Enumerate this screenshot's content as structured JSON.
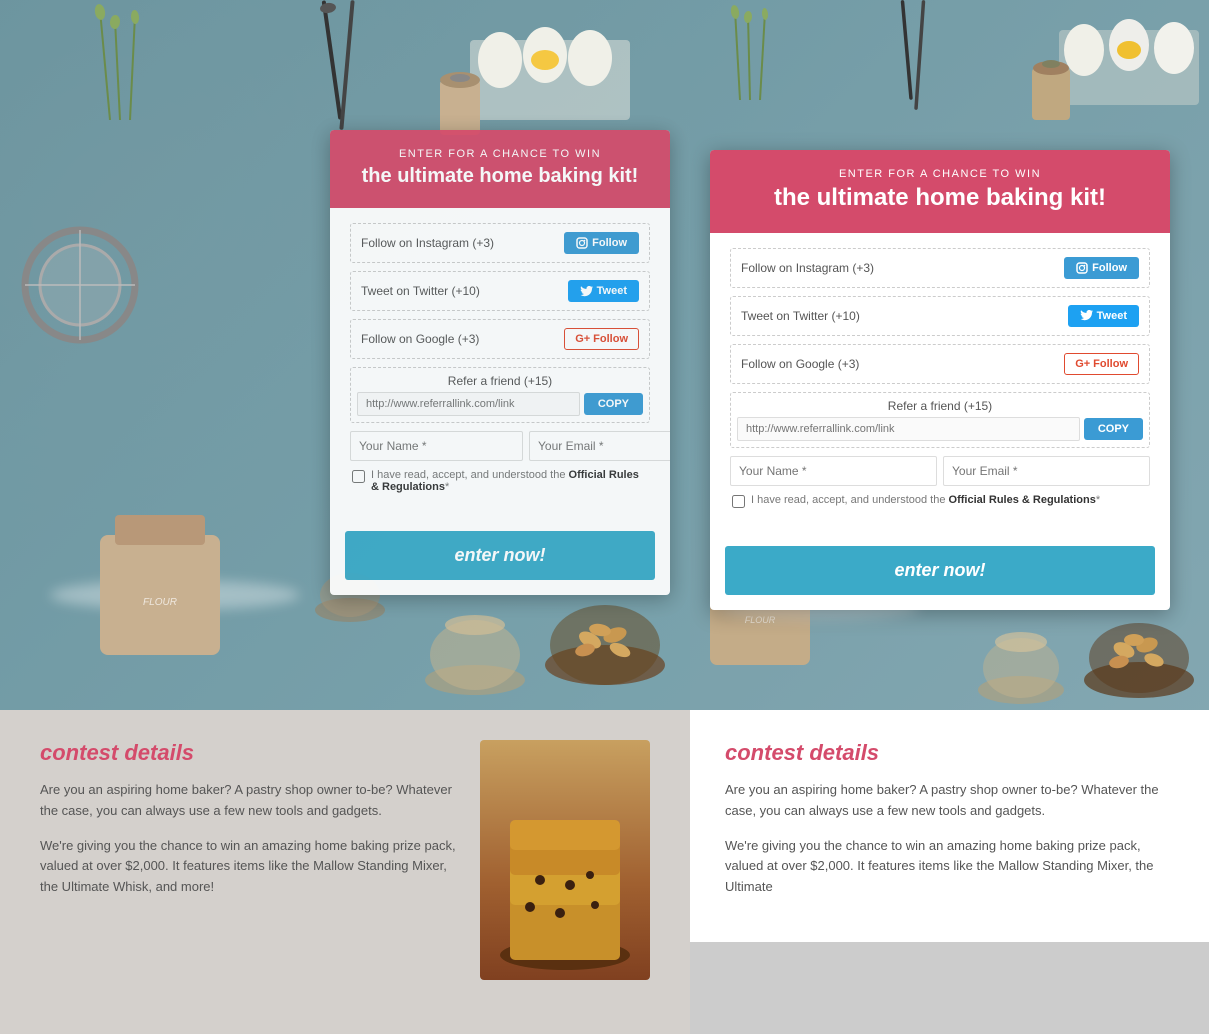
{
  "left_card": {
    "header": {
      "subtitle": "ENTER FOR A CHANCE TO WIN",
      "title": "the ultimate home baking kit!"
    },
    "actions": [
      {
        "label": "Follow on Instagram (+3)",
        "btn_text": "Follow",
        "btn_type": "follow"
      },
      {
        "label": "Tweet on Twitter (+10)",
        "btn_text": "Tweet",
        "btn_type": "tweet"
      },
      {
        "label": "Follow on Google (+3)",
        "btn_text": "Follow",
        "btn_type": "google"
      }
    ],
    "refer": {
      "label": "Refer a friend (+15)",
      "placeholder": "http://www.referrallink.com/link",
      "copy_btn": "COPY"
    },
    "name_placeholder": "Your Name *",
    "email_placeholder": "Your Email *",
    "checkbox_text": "I have read, accept, and understood the ",
    "checkbox_link": "Official Rules & Regulations",
    "checkbox_suffix": "*",
    "enter_btn": "enter now!"
  },
  "right_card": {
    "header": {
      "subtitle": "ENTER FOR A CHANCE TO WIN",
      "title": "the ultimate home baking kit!"
    },
    "actions": [
      {
        "label": "Follow on Instagram (+3)",
        "btn_text": "Follow",
        "btn_type": "follow"
      },
      {
        "label": "Tweet on Twitter (+10)",
        "btn_text": "Tweet",
        "btn_type": "tweet"
      },
      {
        "label": "Follow on Google (+3)",
        "btn_text": "Follow",
        "btn_type": "google"
      }
    ],
    "refer": {
      "label": "Refer a friend (+15)",
      "placeholder": "http://www.referrallink.com/link",
      "copy_btn": "COPY"
    },
    "name_placeholder": "Your Name *",
    "email_placeholder": "Your Email *",
    "checkbox_text": "I have read, accept, and understood the ",
    "checkbox_link": "Official Rules & Regulations",
    "checkbox_suffix": "*",
    "enter_btn": "enter now!"
  },
  "left_details": {
    "title": "contest details",
    "para1": "Are you an aspiring home baker? A pastry shop owner to-be? Whatever the case, you can always use a few new tools and gadgets.",
    "para2": "We're giving you the chance to win an amazing home baking prize pack, valued at over $2,000. It features items like the Mallow Standing Mixer, the Ultimate Whisk, and more!"
  },
  "right_details": {
    "title": "contest details",
    "para1": "Are you an aspiring home baker? A pastry shop owner to-be? Whatever the case, you can always use a few new tools and gadgets.",
    "para2": "We're giving you the chance to win an amazing home baking prize pack, valued at over $2,000. It features items like the Mallow Standing Mixer, the Ultimate"
  },
  "colors": {
    "pink": "#d44b6b",
    "blue": "#3b9bd4",
    "teal": "#3baac8",
    "twitter": "#1da1f2"
  }
}
